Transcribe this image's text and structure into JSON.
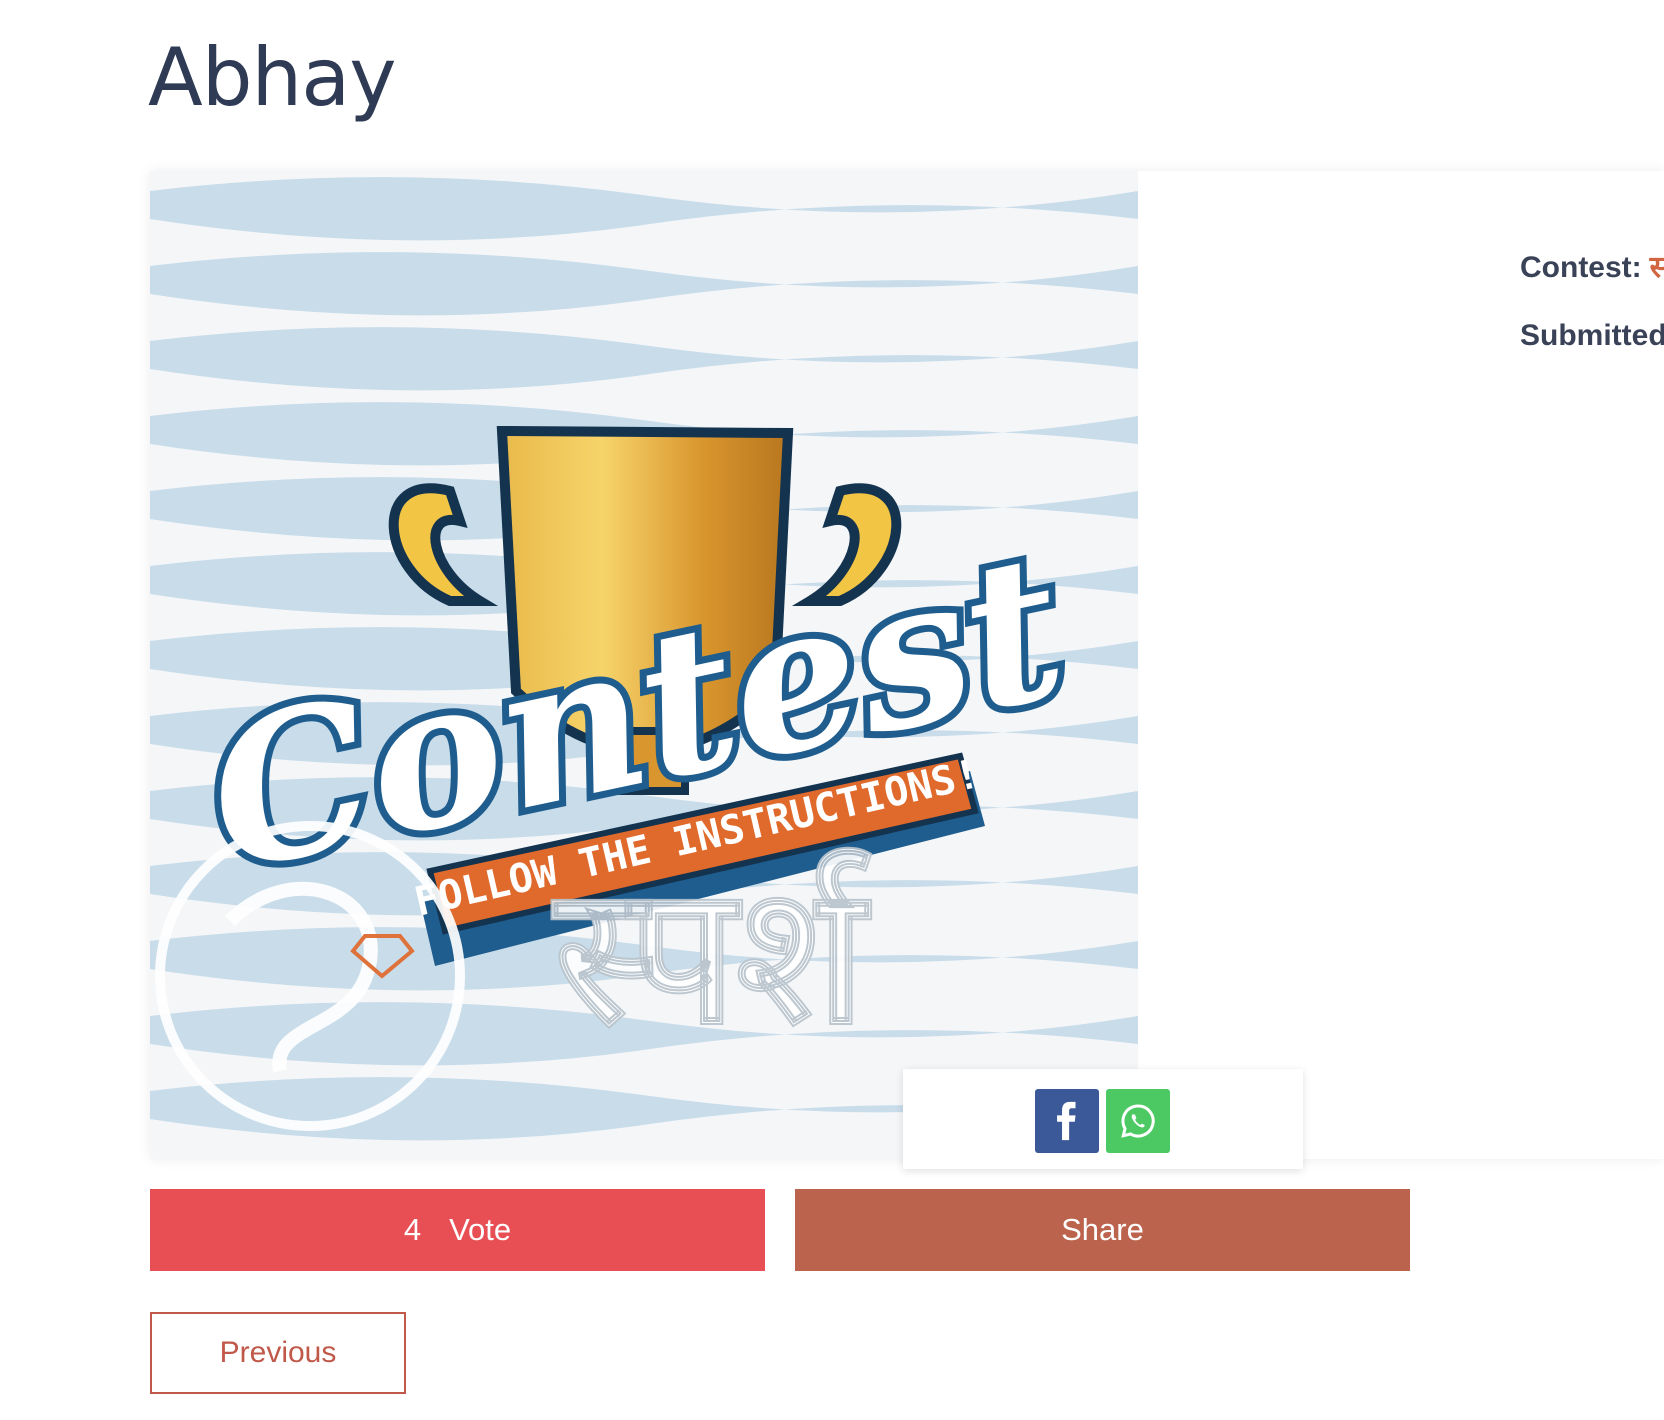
{
  "page": {
    "title": "Abhay"
  },
  "entry": {
    "image_caption": "Contest",
    "image_banner": "FOLLOW THE INSTRUCTIONS!",
    "watermark_text": "स्पर्श"
  },
  "meta": {
    "contest_label": "Contest:",
    "contest_value": "स्",
    "submitted_label": "Submitted"
  },
  "share_popup": {
    "facebook_icon": "facebook-icon",
    "whatsapp_icon": "whatsapp-icon"
  },
  "actions": {
    "vote_count": "4",
    "vote_label": "Vote",
    "share_label": "Share",
    "previous_label": "Previous"
  },
  "colors": {
    "vote": "#e84f55",
    "share": "#bc634e",
    "facebook": "#3b5998",
    "whatsapp": "#4cc963",
    "accent_text": "#d0653f",
    "title": "#2f3b55"
  }
}
